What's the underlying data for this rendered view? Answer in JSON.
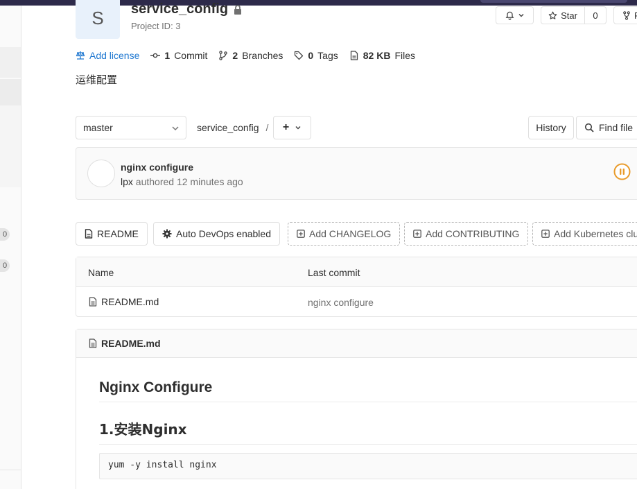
{
  "project": {
    "avatar_letter": "S",
    "name": "service_config",
    "id_text": "Project ID: 3",
    "description": "运维配置"
  },
  "header_actions": {
    "star_label": "Star",
    "star_count": "0",
    "fork_label": "F"
  },
  "stats": {
    "license_label": "Add license",
    "commits_count": "1",
    "commits_label": "Commit",
    "branches_count": "2",
    "branches_label": "Branches",
    "tags_count": "0",
    "tags_label": "Tags",
    "files_size": "82 KB",
    "files_label": "Files"
  },
  "repo_nav": {
    "branch": "master",
    "path": "service_config",
    "separator": "/",
    "add_label": "+",
    "history_label": "History",
    "find_file_label": "Find file"
  },
  "last_commit": {
    "title": "nginx configure",
    "author": "lpx",
    "meta": "authored 12 minutes ago"
  },
  "shortcuts": [
    {
      "label": "README"
    },
    {
      "label": "Auto DevOps enabled"
    },
    {
      "label": "Add CHANGELOG"
    },
    {
      "label": "Add CONTRIBUTING"
    },
    {
      "label": "Add Kubernetes cluster"
    }
  ],
  "file_table": {
    "headers": {
      "name": "Name",
      "last_commit": "Last commit"
    },
    "rows": [
      {
        "name": "README.md",
        "last_commit": "nginx configure"
      }
    ]
  },
  "readme": {
    "filename": "README.md",
    "h1": "Nginx Configure",
    "h2": "1.安装Nginx",
    "code": "yum -y install nginx"
  },
  "sidebar": {
    "counts": [
      "0",
      "0"
    ]
  },
  "colors": {
    "topbar": "#2d2a4a",
    "link": "#1f78d1",
    "pipeline_running": "#e99b2a"
  }
}
